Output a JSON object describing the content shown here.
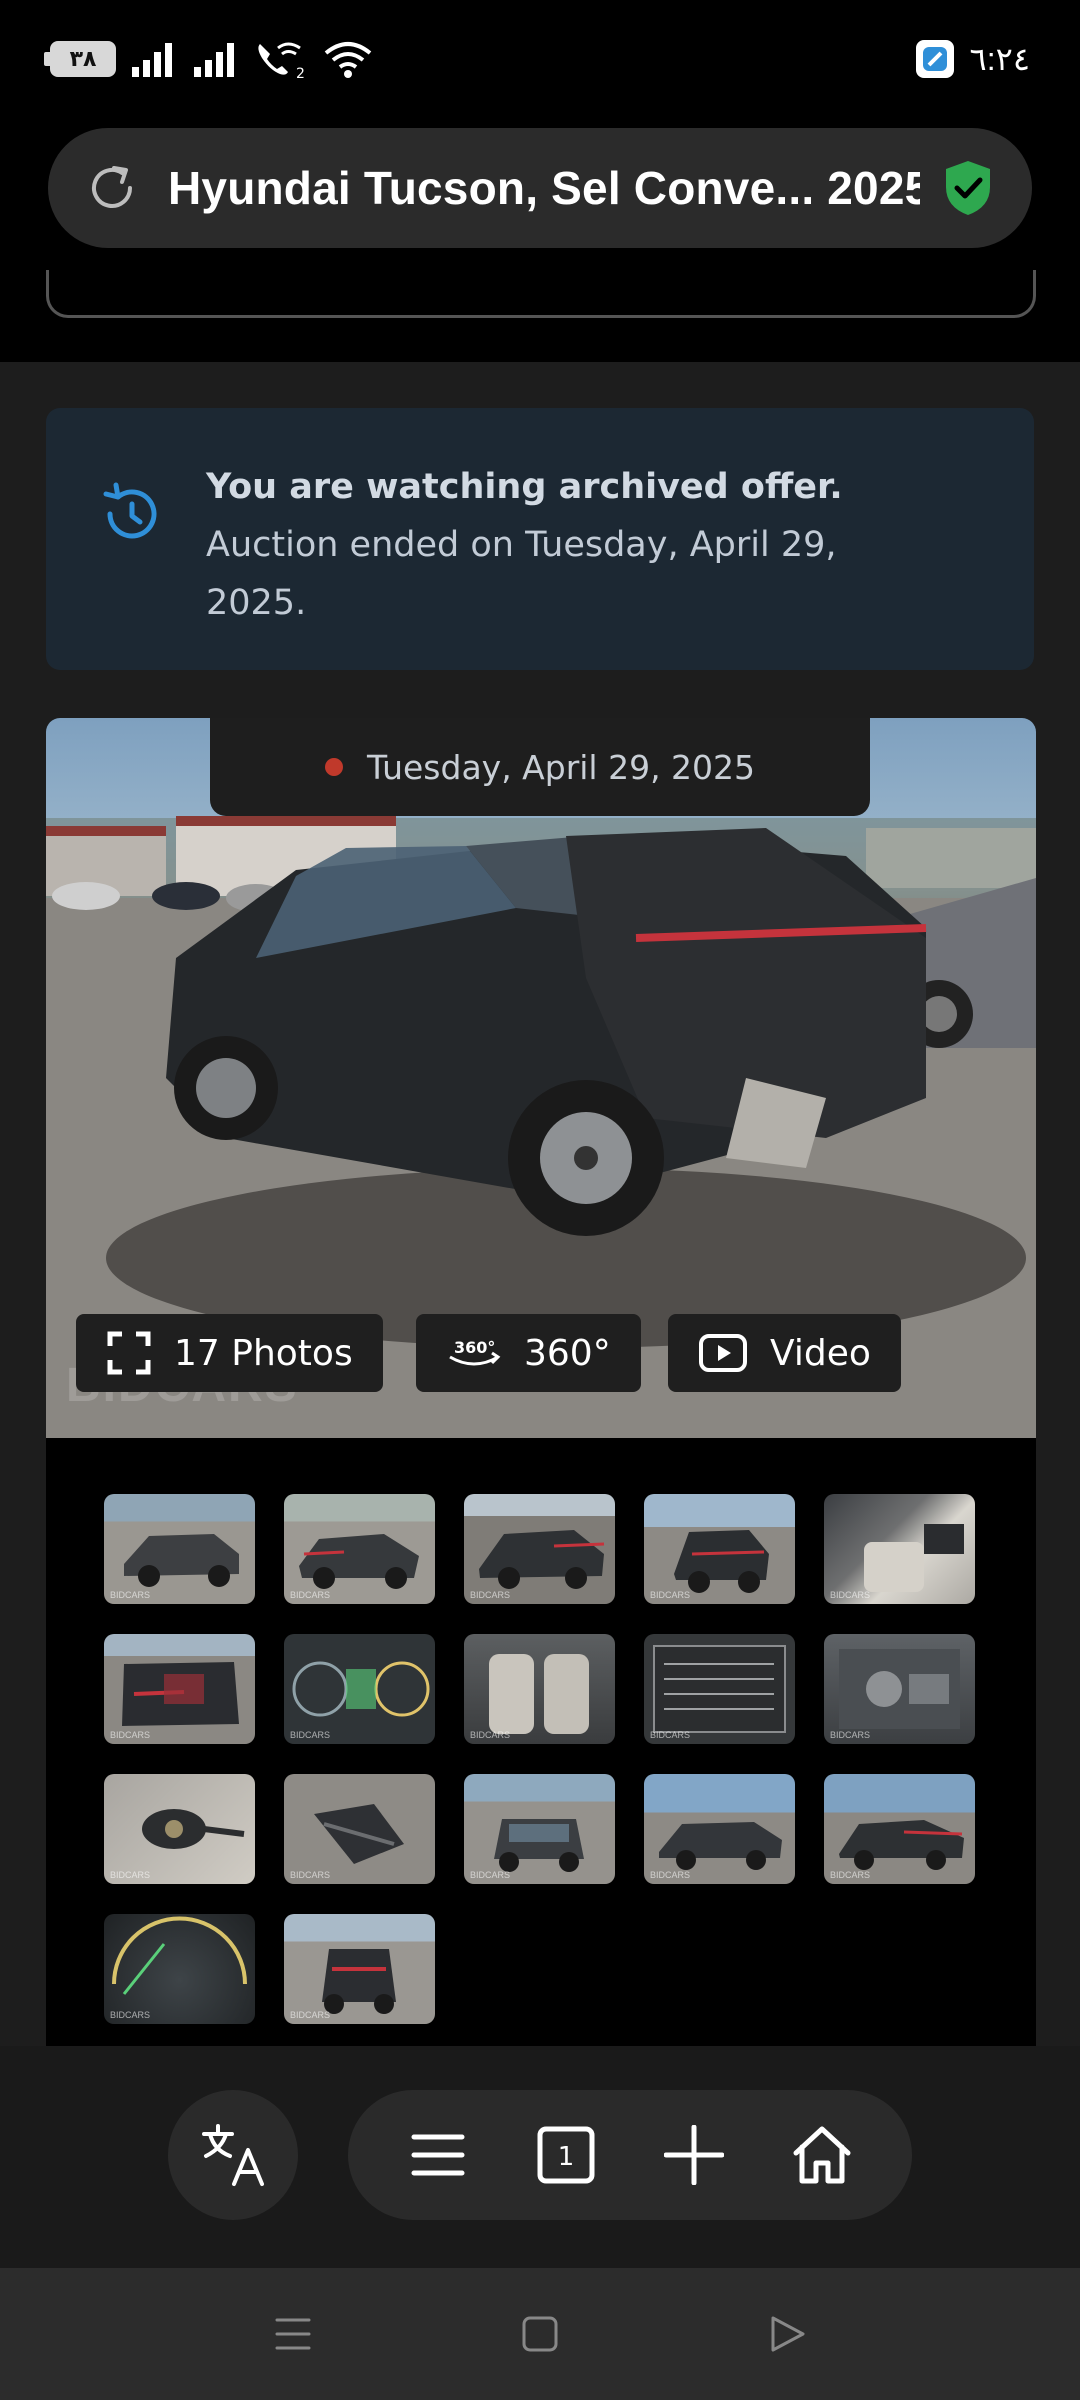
{
  "status_bar": {
    "battery_level": "٣٨",
    "sim2_label": "2",
    "clock": "٦:٢٤"
  },
  "browser": {
    "url_title": "Hyundai Tucson, Sel Conve... 2025"
  },
  "archive_notice": {
    "title": "You are watching archived offer.",
    "body": "Auction ended on Tuesday, April 29, 2025."
  },
  "gallery": {
    "date": "Tuesday, April 29, 2025",
    "watermark": "BIDCARS",
    "photos_label": "17 Photos",
    "degrees_badge": "360°",
    "degrees_label": "360°",
    "video_label": "Video",
    "thumbnail_watermark": "BIDCARS",
    "thumbnail_count": 17
  },
  "toolbar": {
    "tab_count": "1"
  },
  "colors": {
    "accent_blue": "#2f8fd8",
    "shield_green": "#2ea84f",
    "notice_bg": "#1c2833",
    "date_dot": "#c0392b"
  }
}
